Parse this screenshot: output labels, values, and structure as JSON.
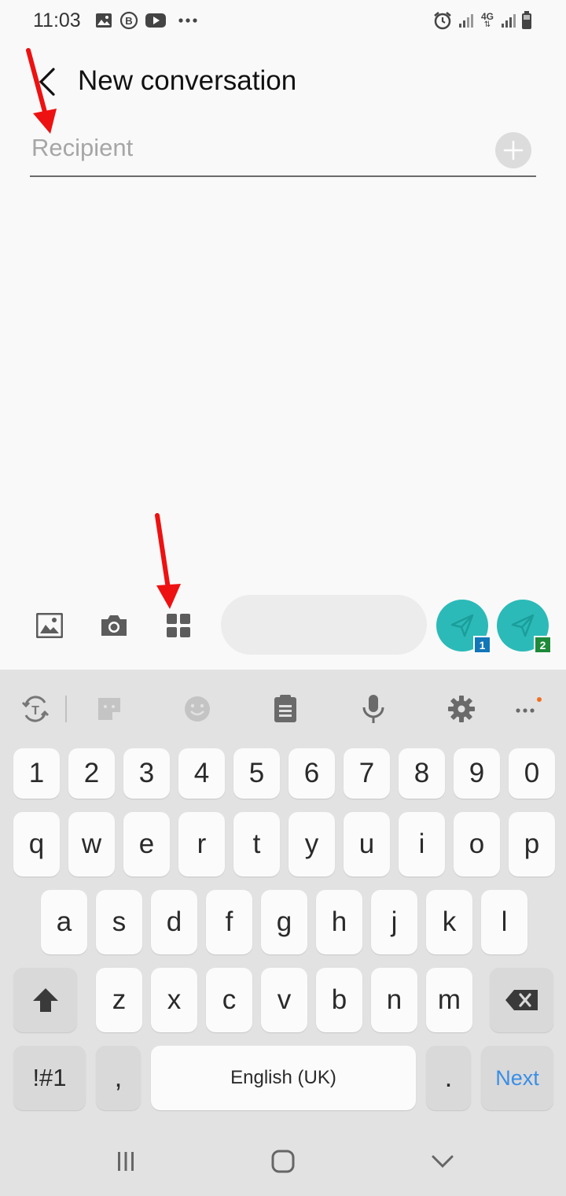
{
  "status_bar": {
    "time": "11:03",
    "left_icons": [
      "image-icon",
      "b-badge-icon",
      "youtube-icon",
      "more-dots-icon"
    ],
    "right_icons": [
      "alarm-icon",
      "signal-icon",
      "4g-icon",
      "signal-icon",
      "battery-icon"
    ],
    "network_label": "4G"
  },
  "header": {
    "title": "New conversation"
  },
  "recipient": {
    "placeholder": "Recipient"
  },
  "compose": {
    "attach_icons": [
      "gallery-icon",
      "camera-icon",
      "apps-grid-icon"
    ],
    "send_buttons": [
      {
        "sim": "1",
        "sim_color": "#1277b8"
      },
      {
        "sim": "2",
        "sim_color": "#1d8a3a"
      }
    ],
    "accent_color": "#2bbab8"
  },
  "keyboard": {
    "toolbar_icons": [
      "translate-icon",
      "sticker-icon",
      "emoji-icon",
      "clipboard-icon",
      "mic-icon",
      "settings-icon",
      "more-icon"
    ],
    "row_numbers": [
      "1",
      "2",
      "3",
      "4",
      "5",
      "6",
      "7",
      "8",
      "9",
      "0"
    ],
    "row1": [
      "q",
      "w",
      "e",
      "r",
      "t",
      "y",
      "u",
      "i",
      "o",
      "p"
    ],
    "row2": [
      "a",
      "s",
      "d",
      "f",
      "g",
      "h",
      "j",
      "k",
      "l"
    ],
    "row3": [
      "z",
      "x",
      "c",
      "v",
      "b",
      "n",
      "m"
    ],
    "symbols_label": "!#1",
    "comma": ",",
    "space_label": "English (UK)",
    "period": ".",
    "next_label": "Next",
    "next_color": "#3a8ee6"
  },
  "annotation_color": "#ee1111"
}
